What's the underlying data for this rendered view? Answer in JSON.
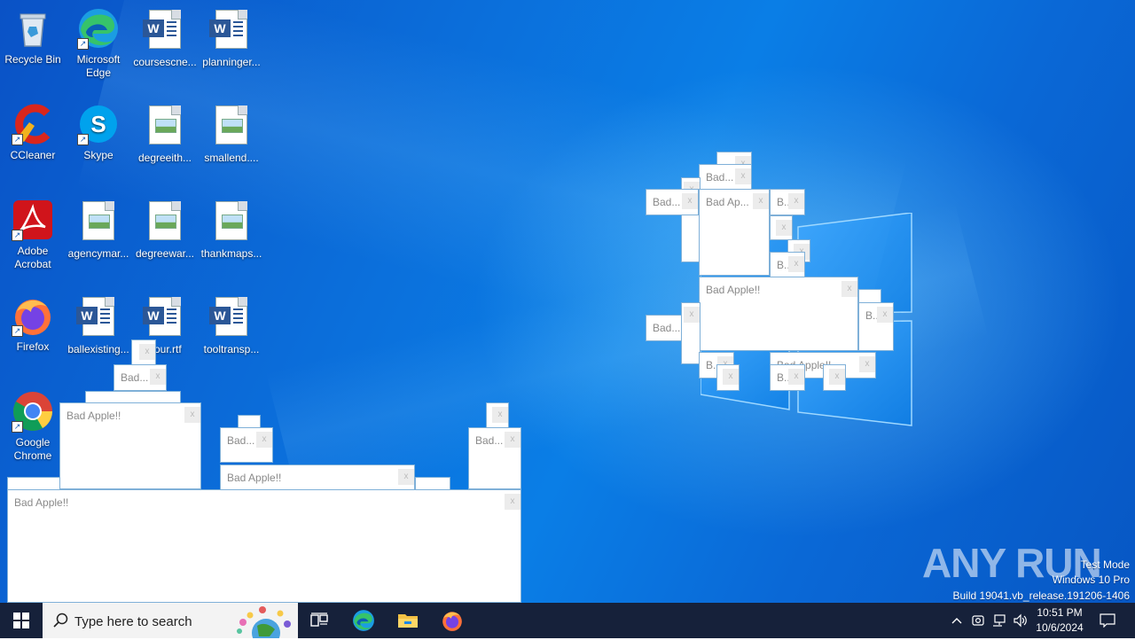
{
  "desktop": {
    "icons": [
      {
        "label": "Recycle Bin"
      },
      {
        "label": "Microsoft Edge"
      },
      {
        "label": "coursescne..."
      },
      {
        "label": "planninger..."
      },
      {
        "label": "CCleaner"
      },
      {
        "label": "Skype"
      },
      {
        "label": "degreeith..."
      },
      {
        "label": "smallend...."
      },
      {
        "label": "Adobe Acrobat"
      },
      {
        "label": "agencymar..."
      },
      {
        "label": "degreewar..."
      },
      {
        "label": "thankmaps..."
      },
      {
        "label": "Firefox"
      },
      {
        "label": "ballexisting..."
      },
      {
        "label": "hour.rtf"
      },
      {
        "label": "tooltransp..."
      },
      {
        "label": "Google Chrome"
      }
    ],
    "popups": {
      "full": "Bad Apple!!",
      "short": "Bad...",
      "short2": "Bad Ap...",
      "tiny": "B...",
      "close": "x"
    },
    "watermark": {
      "logo": "ANY RUN",
      "line1": "Test Mode",
      "line2": "Windows 10 Pro",
      "line3": "Build 19041.vb_release.191206-1406"
    }
  },
  "taskbar": {
    "search_placeholder": "Type here to search",
    "clock_time": "10:51 PM",
    "clock_date": "10/6/2024",
    "apps": [
      "task-view",
      "edge",
      "file-explorer",
      "firefox"
    ]
  },
  "colors": {
    "desktop_blue": "#0a6fdb",
    "taskbar": "#16213a",
    "popup_border": "#7fb0d8"
  }
}
